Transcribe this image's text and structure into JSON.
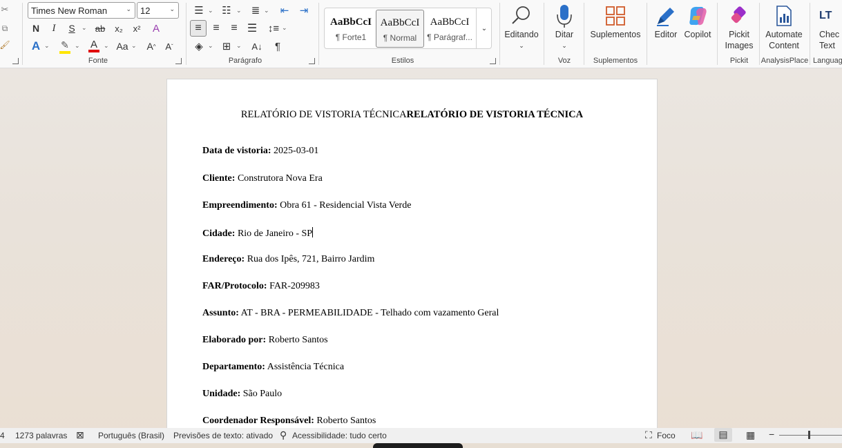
{
  "ribbon": {
    "font": {
      "family": "Times New Roman",
      "size": "12",
      "bold": "N",
      "italic": "I",
      "underline": "S",
      "strike": "ab",
      "sub": "x₂",
      "sup": "x²",
      "case": "Aa",
      "grow": "A",
      "shrink": "A",
      "group_label": "Fonte"
    },
    "paragraph": {
      "group_label": "Parágrafo"
    },
    "styles": {
      "items": [
        {
          "sample": "AaBbCcI",
          "name": "¶ Forte1"
        },
        {
          "sample": "AaBbCcI",
          "name": "¶ Normal"
        },
        {
          "sample": "AaBbCcI",
          "name": "¶ Parágraf..."
        }
      ],
      "group_label": "Estilos"
    },
    "editing": {
      "label": "Editando"
    },
    "voice": {
      "label": "Ditar",
      "group_label": "Voz"
    },
    "addins": {
      "label": "Suplementos",
      "group_label": "Suplementos"
    },
    "editor": {
      "label": "Editor"
    },
    "copilot": {
      "label": "Copilot"
    },
    "pickit": {
      "label1": "Pickit",
      "label2": "Images",
      "group_label": "Pickit"
    },
    "automate": {
      "label1": "Automate",
      "label2": "Content",
      "group_label": "AnalysisPlace"
    },
    "check": {
      "label1": "Chec",
      "label2": "Text",
      "group_label": "Languag"
    },
    "colors": {
      "accent": "#2b579a",
      "highlight": "#ffe600",
      "font_color": "#e00000"
    }
  },
  "document": {
    "title_normal": "RELATÓRIO DE VISTORIA TÉCNICA",
    "title_bold": "RELATÓRIO DE VISTORIA TÉCNICA",
    "fields": [
      {
        "label": "Data de vistoria:",
        "value": "2025-03-01"
      },
      {
        "label": "Cliente:",
        "value": "Construtora Nova Era"
      },
      {
        "label": "Empreendimento:",
        "value": "Obra 61 - Residencial Vista Verde"
      },
      {
        "label": "Cidade:",
        "value": "Rio de Janeiro - SP"
      },
      {
        "label": "Endereço:",
        "value": "Rua dos Ipês, 721, Bairro Jardim"
      },
      {
        "label": "FAR/Protocolo:",
        "value": "FAR-209983"
      },
      {
        "label": "Assunto:",
        "value": "AT - BRA - PERMEABILIDADE - Telhado com vazamento Geral"
      },
      {
        "label": "Elaborado por:",
        "value": "Roberto Santos"
      },
      {
        "label": "Departamento:",
        "value": "Assistência Técnica"
      },
      {
        "label": "Unidade:",
        "value": "São Paulo"
      },
      {
        "label": "Coordenador Responsável:",
        "value": "Roberto Santos"
      }
    ]
  },
  "status": {
    "page_indicator": "4",
    "words": "1273 palavras",
    "language": "Português (Brasil)",
    "text_predictions": "Previsões de texto: ativado",
    "accessibility": "Acessibilidade: tudo certo",
    "focus": "Foco"
  }
}
